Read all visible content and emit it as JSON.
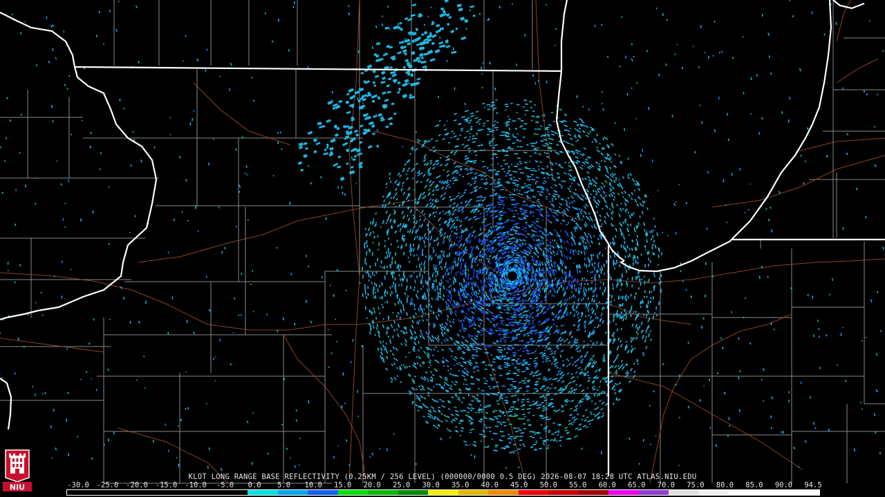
{
  "product": {
    "caption": "KLOT LONG RANGE BASE REFLECTIVITY (0.25KM / 256 LEVEL) (000000/0000 0.5 DEG) 2026-08-07 18:28 UTC  ATLAS.NIU.EDU",
    "radar_site": "KLOT",
    "timestamp": "2026-08-07 18:28 UTC",
    "source": "ATLAS.NIU.EDU"
  },
  "logo": {
    "text": "NIU",
    "colors": [
      "#c8102e",
      "#ffffff"
    ]
  },
  "colorbar": {
    "tick_labels": [
      "-30.0",
      "-25.0",
      "-20.0",
      "-15.0",
      "-10.0",
      "-5.0",
      "0.0",
      "5.0",
      "10.0",
      "15.0",
      "20.0",
      "25.0",
      "30.0",
      "35.0",
      "40.0",
      "45.0",
      "50.0",
      "55.0",
      "60.0",
      "65.0",
      "70.0",
      "75.0",
      "80.0",
      "85.0",
      "90.0",
      "94.5"
    ],
    "segment_colors": [
      "#000000",
      "#000000",
      "#000000",
      "#000000",
      "#000000",
      "#000000",
      "#00e0e0",
      "#00a8f0",
      "#1060f0",
      "#00e000",
      "#00b800",
      "#008800",
      "#f0f000",
      "#e0b800",
      "#f08800",
      "#f00000",
      "#c80000",
      "#a00000",
      "#f000f0",
      "#9040d0",
      "#e0e0e0",
      "#f0f0f0",
      "#ffffff",
      "#ffffff",
      "#ffffff"
    ]
  },
  "map_colors": {
    "background": "#000000",
    "state_borders": "#ffffff",
    "coastline": "#ffffff",
    "county_lines": "#8a8a8a",
    "highways": "#a0522d",
    "radar_light": "#1fb6e0",
    "radar_mid": "#1f8de6",
    "radar_dark": "#1a4fe0",
    "radar_green": "#14b478"
  }
}
